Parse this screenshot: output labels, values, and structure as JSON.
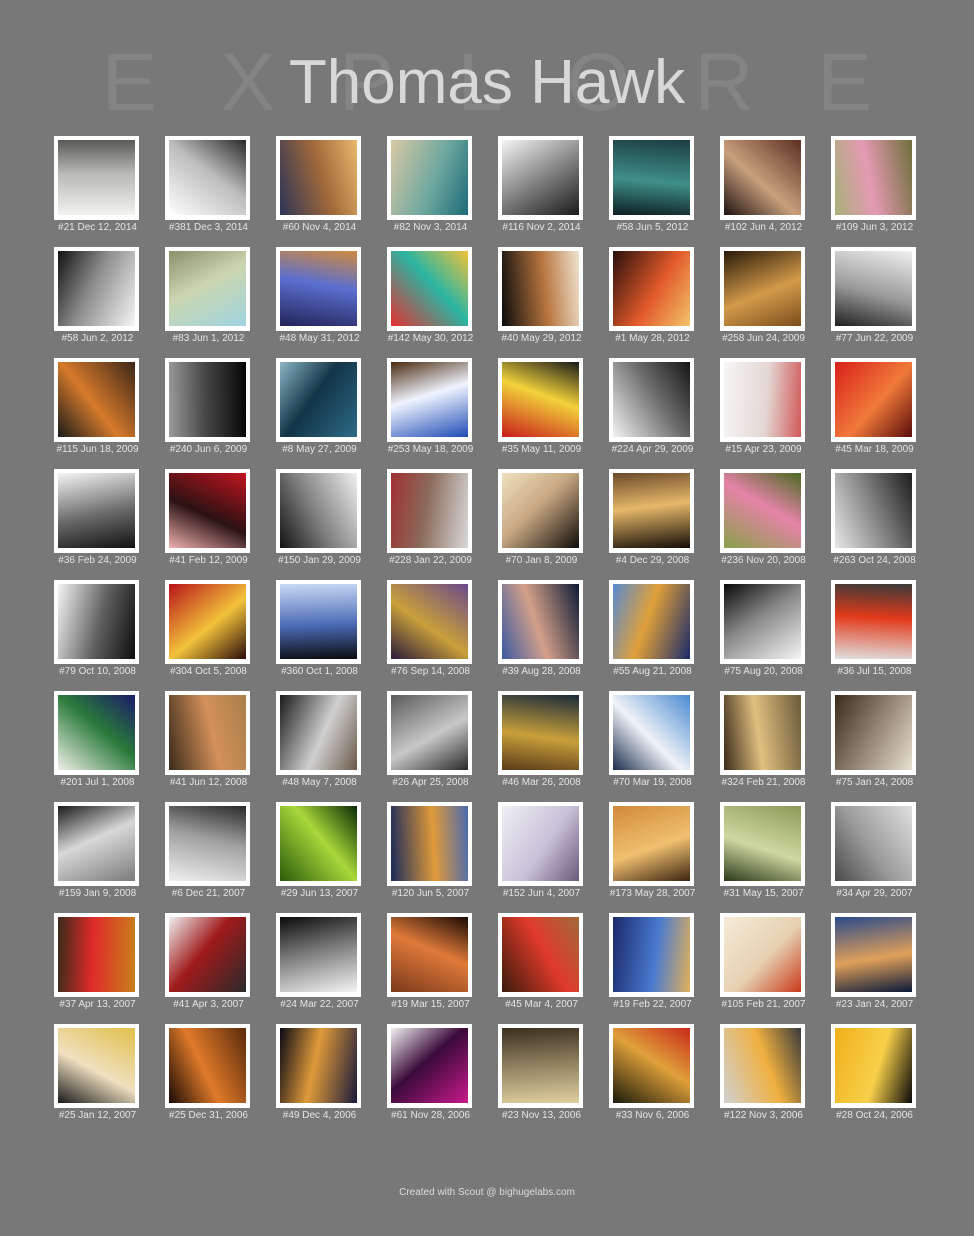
{
  "header": {
    "title": "Thomas Hawk",
    "background_letters": [
      "E",
      "X",
      "P",
      "L",
      "O",
      "R",
      "E"
    ]
  },
  "photos": [
    {
      "caption": "#21 Dec 12, 2014",
      "colors": [
        "#f2f2f0",
        "#b9b9b5",
        "#5a5a56"
      ]
    },
    {
      "caption": "#381 Dec 3, 2014",
      "colors": [
        "#ffffff",
        "#bdbdbd",
        "#2a2a2a"
      ]
    },
    {
      "caption": "#60 Nov 4, 2014",
      "colors": [
        "#2c3456",
        "#a36a3a",
        "#e9b86d"
      ]
    },
    {
      "caption": "#82 Nov 3, 2014",
      "colors": [
        "#d9c8a5",
        "#6fa89f",
        "#1b6b78"
      ]
    },
    {
      "caption": "#116 Nov 2, 2014",
      "colors": [
        "#f5f5f5",
        "#7a7a7a",
        "#1a1a1a"
      ]
    },
    {
      "caption": "#58 Jun 5, 2012",
      "colors": [
        "#1c3d44",
        "#3f8f88",
        "#0e1e22"
      ]
    },
    {
      "caption": "#102 Jun 4, 2012",
      "colors": [
        "#5a2f22",
        "#c9a07c",
        "#1f1210"
      ]
    },
    {
      "caption": "#109 Jun 3, 2012",
      "colors": [
        "#6e6f3b",
        "#e59ab3",
        "#a8b07a"
      ]
    },
    {
      "caption": "#58 Jun 2, 2012",
      "colors": [
        "#f7f7f7",
        "#8c8c8c",
        "#121212"
      ]
    },
    {
      "caption": "#83 Jun 1, 2012",
      "colors": [
        "#9fd4e0",
        "#cbd6b0",
        "#8b8f6a"
      ]
    },
    {
      "caption": "#48 May 31, 2012",
      "colors": [
        "#24245a",
        "#5a6fcf",
        "#d08a3f"
      ]
    },
    {
      "caption": "#142 May 30, 2012",
      "colors": [
        "#e23030",
        "#2bb5a3",
        "#f0c23a"
      ]
    },
    {
      "caption": "#40 May 29, 2012",
      "colors": [
        "#0b0b0b",
        "#b8753f",
        "#f0e3d0"
      ]
    },
    {
      "caption": "#1 May 28, 2012",
      "colors": [
        "#2a0f0c",
        "#e25a2a",
        "#f3c46b"
      ]
    },
    {
      "caption": "#258 Jun 24, 2009",
      "colors": [
        "#2a1a08",
        "#d39a4a",
        "#7a4d1c"
      ]
    },
    {
      "caption": "#77 Jun 22, 2009",
      "colors": [
        "#f0f0f0",
        "#9a9a9a",
        "#202020"
      ]
    },
    {
      "caption": "#115 Jun 18, 2009",
      "colors": [
        "#3c2617",
        "#d67a2b",
        "#1a1a1a"
      ]
    },
    {
      "caption": "#240 Jun 6, 2009",
      "colors": [
        "#050505",
        "#4a4a4a",
        "#9a9a9a"
      ]
    },
    {
      "caption": "#8 May 27, 2009",
      "colors": [
        "#2d6b87",
        "#123446",
        "#8bb5c4"
      ]
    },
    {
      "caption": "#253 May 18, 2009",
      "colors": [
        "#1e4bb5",
        "#f0f4ff",
        "#4a2a10"
      ]
    },
    {
      "caption": "#35 May 11, 2009",
      "colors": [
        "#c81b1b",
        "#f2d23a",
        "#1a1a1a"
      ]
    },
    {
      "caption": "#224 Apr 29, 2009",
      "colors": [
        "#f2f2f2",
        "#6e6e6e",
        "#151515"
      ]
    },
    {
      "caption": "#15 Apr 23, 2009",
      "colors": [
        "#f6f6f6",
        "#e4d7d3",
        "#d05a5a"
      ]
    },
    {
      "caption": "#45 Mar 18, 2009",
      "colors": [
        "#d8201a",
        "#f07a3a",
        "#5a0d0a"
      ]
    },
    {
      "caption": "#36 Feb 24, 2009",
      "colors": [
        "#f5f5f5",
        "#6a6a6a",
        "#111111"
      ]
    },
    {
      "caption": "#41 Feb 12, 2009",
      "colors": [
        "#c2141f",
        "#2a1212",
        "#f0b0b0"
      ]
    },
    {
      "caption": "#150 Jan 29, 2009",
      "colors": [
        "#f0f0f0",
        "#7e7e7e",
        "#121212"
      ]
    },
    {
      "caption": "#228 Jan 22, 2009",
      "colors": [
        "#d9d9d9",
        "#8a6a5a",
        "#a03030"
      ]
    },
    {
      "caption": "#70 Jan 8, 2009",
      "colors": [
        "#100c08",
        "#c8a882",
        "#f0e0c0"
      ]
    },
    {
      "caption": "#4 Dec 29, 2008",
      "colors": [
        "#150d06",
        "#e6b86a",
        "#6a4a2a"
      ]
    },
    {
      "caption": "#236 Nov 20, 2008",
      "colors": [
        "#8aa04a",
        "#e583a8",
        "#4a6a22"
      ]
    },
    {
      "caption": "#263 Oct 24, 2008",
      "colors": [
        "#e8e8e8",
        "#7a7a7a",
        "#1c1c1c"
      ]
    },
    {
      "caption": "#79 Oct 10, 2008",
      "colors": [
        "#f4f4f4",
        "#5e5e5e",
        "#0d0d0d"
      ]
    },
    {
      "caption": "#304 Oct 5, 2008",
      "colors": [
        "#b8141a",
        "#f2c23a",
        "#2a0c0c"
      ]
    },
    {
      "caption": "#360 Oct 1, 2008",
      "colors": [
        "#c9d9f5",
        "#4a6ab5",
        "#0c0c10"
      ]
    },
    {
      "caption": "#76 Sep 14, 2008",
      "colors": [
        "#6a4a8a",
        "#c9a03a",
        "#2a1a3a"
      ]
    },
    {
      "caption": "#39 Aug 28, 2008",
      "colors": [
        "#0d1a36",
        "#d4a08a",
        "#3a5aa0"
      ]
    },
    {
      "caption": "#55 Aug 21, 2008",
      "colors": [
        "#1a2a6a",
        "#e0a03a",
        "#5a8ad0"
      ]
    },
    {
      "caption": "#75 Aug 20, 2008",
      "colors": [
        "#f5f5f5",
        "#888888",
        "#0a0a0a"
      ]
    },
    {
      "caption": "#36 Jul 15, 2008",
      "colors": [
        "#e0e0e0",
        "#e23a1a",
        "#3a3a3a"
      ]
    },
    {
      "caption": "#201 Jul 1, 2008",
      "colors": [
        "#f0f0e8",
        "#2a7a3a",
        "#1a1a6a"
      ]
    },
    {
      "caption": "#41 Jun 12, 2008",
      "colors": [
        "#3a2a1a",
        "#d4905a",
        "#a8804a"
      ]
    },
    {
      "caption": "#48 May 7, 2008",
      "colors": [
        "#1a1a1a",
        "#d0d0d0",
        "#6a5a4a"
      ]
    },
    {
      "caption": "#26 Apr 25, 2008",
      "colors": [
        "#5a5a5a",
        "#c8c8c8",
        "#2a2a2a"
      ]
    },
    {
      "caption": "#46 Mar 26, 2008",
      "colors": [
        "#1a2a3a",
        "#c8a03a",
        "#5a3a1a"
      ]
    },
    {
      "caption": "#70 Mar 19, 2008",
      "colors": [
        "#4a8ad0",
        "#f0f4f8",
        "#1a2a4a"
      ]
    },
    {
      "caption": "#324 Feb 21, 2008",
      "colors": [
        "#6a5a3a",
        "#e0c080",
        "#3a2a1a"
      ]
    },
    {
      "caption": "#75 Jan 24, 2008",
      "colors": [
        "#e8e0d0",
        "#8a7a6a",
        "#3a2a1a"
      ]
    },
    {
      "caption": "#159 Jan 9, 2008",
      "colors": [
        "#7a7a7a",
        "#d8d8d8",
        "#1a1a1a"
      ]
    },
    {
      "caption": "#6 Dec 21, 2007",
      "colors": [
        "#f0f0f0",
        "#a0a0a0",
        "#2a2a2a"
      ]
    },
    {
      "caption": "#29 Jun 13, 2007",
      "colors": [
        "#2a5a0a",
        "#a8d83a",
        "#0a2a04"
      ]
    },
    {
      "caption": "#120 Jun 5, 2007",
      "colors": [
        "#1a2a5a",
        "#e09a3a",
        "#4a6ab0"
      ]
    },
    {
      "caption": "#152 Jun 4, 2007",
      "colors": [
        "#f0f0f4",
        "#c8c0d8",
        "#6a5a7a"
      ]
    },
    {
      "caption": "#173 May 28, 2007",
      "colors": [
        "#d08a3a",
        "#f0c070",
        "#3a2410"
      ]
    },
    {
      "caption": "#31 May 15, 2007",
      "colors": [
        "#8a9a5a",
        "#d0d8a0",
        "#2a3a1a"
      ]
    },
    {
      "caption": "#34 Apr 29, 2007",
      "colors": [
        "#e0e0e0",
        "#9a9a9a",
        "#4a4a4a"
      ]
    },
    {
      "caption": "#37 Apr 13, 2007",
      "colors": [
        "#c8801a",
        "#e02a2a",
        "#3a2a1a"
      ]
    },
    {
      "caption": "#41 Apr 3, 2007",
      "colors": [
        "#2a2a2a",
        "#a01a1a",
        "#f0f0f0"
      ]
    },
    {
      "caption": "#24 Mar 22, 2007",
      "colors": [
        "#f5f5f5",
        "#7a7a7a",
        "#0a0a0a"
      ]
    },
    {
      "caption": "#19 Mar 15, 2007",
      "colors": [
        "#7a3a1a",
        "#e07a3a",
        "#1a0a04"
      ]
    },
    {
      "caption": "#45 Mar 4, 2007",
      "colors": [
        "#3a1a0a",
        "#e03a2a",
        "#a06a3a"
      ]
    },
    {
      "caption": "#19 Feb 22, 2007",
      "colors": [
        "#1a2a6a",
        "#4a7ad0",
        "#e0b05a"
      ]
    },
    {
      "caption": "#105 Feb 21, 2007",
      "colors": [
        "#f5ecd8",
        "#e6d0b0",
        "#c83a1a"
      ]
    },
    {
      "caption": "#23 Jan 24, 2007",
      "colors": [
        "#2a4a8a",
        "#e0a05a",
        "#0a1a3a"
      ]
    },
    {
      "caption": "#25 Jan 12, 2007",
      "colors": [
        "#e0c04a",
        "#f0e0c0",
        "#1a1a1a"
      ]
    },
    {
      "caption": "#25 Dec 31, 2006",
      "colors": [
        "#5a2a0a",
        "#e07a2a",
        "#1a0a04"
      ]
    },
    {
      "caption": "#49 Dec 4, 2006",
      "colors": [
        "#1a1a3a",
        "#e09a3a",
        "#0a0a14"
      ]
    },
    {
      "caption": "#61 Nov 28, 2006",
      "colors": [
        "#c81a8a",
        "#3a0a3a",
        "#f0f0f0"
      ]
    },
    {
      "caption": "#23 Nov 13, 2006",
      "colors": [
        "#e0d0a0",
        "#8a7a5a",
        "#3a3020"
      ]
    },
    {
      "caption": "#33 Nov 6, 2006",
      "colors": [
        "#1a1a0a",
        "#e0a03a",
        "#c82a1a"
      ]
    },
    {
      "caption": "#122 Nov 3, 2006",
      "colors": [
        "#d0d0d0",
        "#f0b040",
        "#3a3a3a"
      ]
    },
    {
      "caption": "#28 Oct 24, 2006",
      "colors": [
        "#f0b01a",
        "#f8d04a",
        "#0a0a0a"
      ]
    }
  ],
  "footer": {
    "text": "Created with Scout @ bighugelabs.com"
  }
}
